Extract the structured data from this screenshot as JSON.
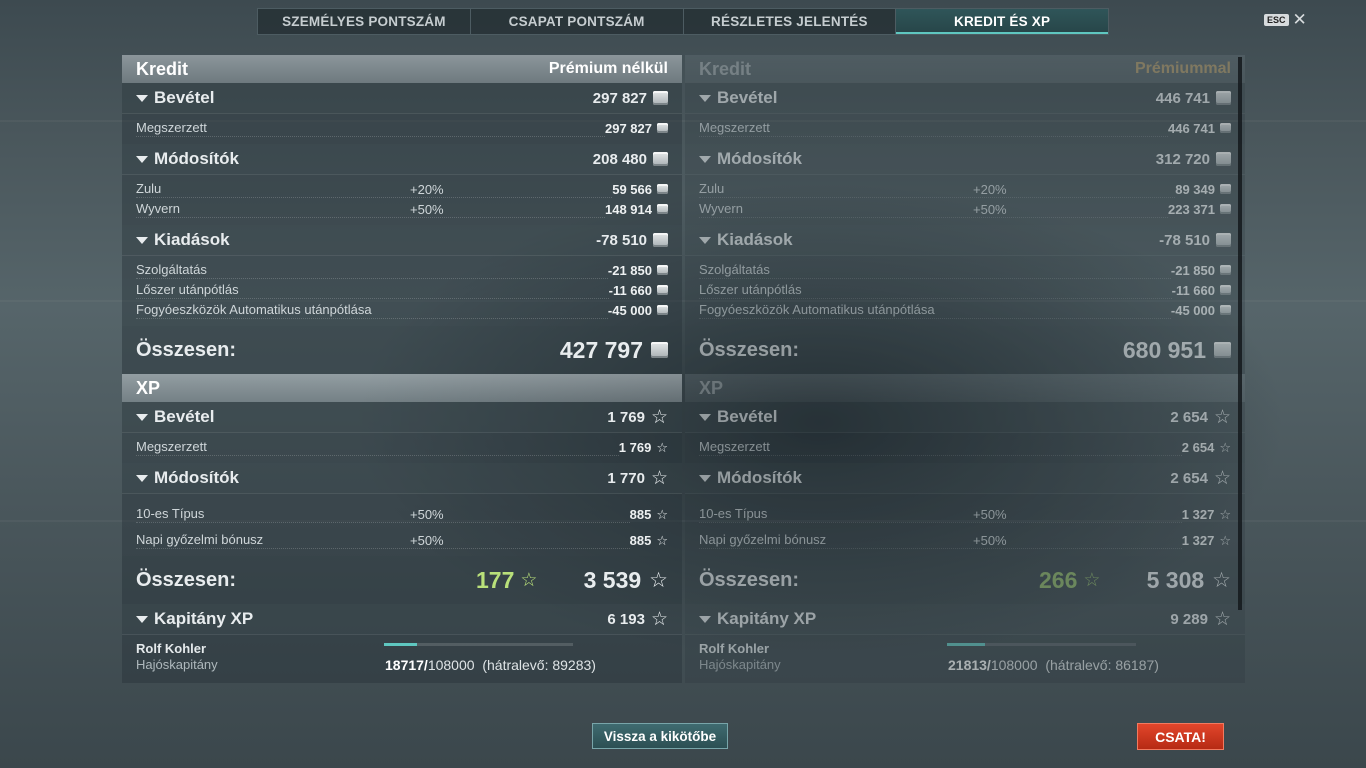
{
  "tabs": [
    "SZEMÉLYES PONTSZÁM",
    "CSAPAT PONTSZÁM",
    "RÉSZLETES JELENTÉS",
    "KREDIT ÉS XP"
  ],
  "active_tab": 3,
  "esc_label": "ESC",
  "left": {
    "credit_title": "Kredit",
    "credit_mode": "Prémium nélkül",
    "income_label": "Bevétel",
    "income_value": "297 827",
    "earned_label": "Megszerzett",
    "earned_value": "297 827",
    "mods_label": "Módosítók",
    "mods_value": "208 480",
    "mod1_name": "Zulu",
    "mod1_pct": "+20%",
    "mod1_value": "59 566",
    "mod2_name": "Wyvern",
    "mod2_pct": "+50%",
    "mod2_value": "148 914",
    "exp_label": "Kiadások",
    "exp_value": "-78 510",
    "exp1_name": "Szolgáltatás",
    "exp1_value": "-21 850",
    "exp2_name": "Lőszer utánpótlás",
    "exp2_value": "-11 660",
    "exp3_name": "Fogyóeszközök Automatikus utánpótlása",
    "exp3_value": "-45 000",
    "credit_total_label": "Összesen:",
    "credit_total_value": "427 797",
    "xp_title": "XP",
    "xp_income_label": "Bevétel",
    "xp_income_value": "1 769",
    "xp_earned_label": "Megszerzett",
    "xp_earned_value": "1 769",
    "xp_mods_label": "Módosítók",
    "xp_mods_value": "1 770",
    "xmod1_name": "10-es Típus",
    "xmod1_pct": "+50%",
    "xmod1_value": "885",
    "xmod2_name": "Napi győzelmi bónusz",
    "xmod2_pct": "+50%",
    "xmod2_value": "885",
    "xp_total_label": "Összesen:",
    "xp_bonus": "177",
    "xp_total_value": "3 539",
    "capt_label": "Kapitány XP",
    "capt_value": "6 193",
    "capt_name": "Rolf Kohler",
    "capt_rank": "Hajóskapitány",
    "capt_xp_current": "18717/",
    "capt_xp_max": "108000",
    "capt_xp_remaining": "(hátralevő: 89283)",
    "capt_progress": 0.173
  },
  "right": {
    "credit_title": "Kredit",
    "credit_mode": "Prémiummal",
    "income_label": "Bevétel",
    "income_value": "446 741",
    "earned_label": "Megszerzett",
    "earned_value": "446 741",
    "mods_label": "Módosítók",
    "mods_value": "312 720",
    "mod1_name": "Zulu",
    "mod1_pct": "+20%",
    "mod1_value": "89 349",
    "mod2_name": "Wyvern",
    "mod2_pct": "+50%",
    "mod2_value": "223 371",
    "exp_label": "Kiadások",
    "exp_value": "-78 510",
    "exp1_name": "Szolgáltatás",
    "exp1_value": "-21 850",
    "exp2_name": "Lőszer utánpótlás",
    "exp2_value": "-11 660",
    "exp3_name": "Fogyóeszközök Automatikus utánpótlása",
    "exp3_value": "-45 000",
    "credit_total_label": "Összesen:",
    "credit_total_value": "680 951",
    "xp_title": "XP",
    "xp_income_label": "Bevétel",
    "xp_income_value": "2 654",
    "xp_earned_label": "Megszerzett",
    "xp_earned_value": "2 654",
    "xp_mods_label": "Módosítók",
    "xp_mods_value": "2 654",
    "xmod1_name": "10-es Típus",
    "xmod1_pct": "+50%",
    "xmod1_value": "1 327",
    "xmod2_name": "Napi győzelmi bónusz",
    "xmod2_pct": "+50%",
    "xmod2_value": "1 327",
    "xp_total_label": "Összesen:",
    "xp_bonus": "266",
    "xp_total_value": "5 308",
    "capt_label": "Kapitány XP",
    "capt_value": "9 289",
    "capt_name": "Rolf Kohler",
    "capt_rank": "Hajóskapitány",
    "capt_xp_current": "21813/",
    "capt_xp_max": "108000",
    "capt_xp_remaining": "(hátralevő: 86187)",
    "capt_progress": 0.202
  },
  "buttons": {
    "back_to_port": "Vissza a kikötőbe",
    "battle": "CSATA!"
  },
  "colors": {
    "accent": "#5fc7c0",
    "battle": "#d23a20",
    "bonus_xp": "#b9e07a",
    "premium_label": "#c9a86a"
  },
  "icons": {
    "credit": "credit-coin-icon",
    "xp": "xp-star-icon"
  }
}
